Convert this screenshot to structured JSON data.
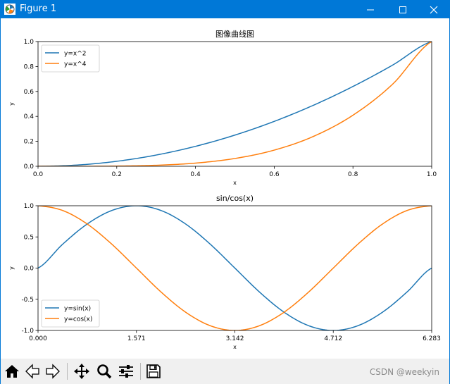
{
  "window": {
    "title": "Figure 1",
    "controls": {
      "minimize": "minimize",
      "maximize": "maximize",
      "close": "close"
    },
    "titlebar_color": "#0078d7"
  },
  "toolbar": {
    "buttons": [
      {
        "name": "home-button",
        "icon": "home-icon",
        "label": "Home"
      },
      {
        "name": "back-button",
        "icon": "back-arrow-icon",
        "label": "Back"
      },
      {
        "name": "forward-button",
        "icon": "forward-arrow-icon",
        "label": "Forward"
      },
      {
        "name": "pan-button",
        "icon": "move-icon",
        "label": "Pan"
      },
      {
        "name": "zoom-button",
        "icon": "magnifier-icon",
        "label": "Zoom"
      },
      {
        "name": "configure-subplots-button",
        "icon": "sliders-icon",
        "label": "Subplots"
      },
      {
        "name": "save-button",
        "icon": "save-icon",
        "label": "Save"
      }
    ],
    "watermark": "CSDN @weekyin"
  },
  "chart_data": [
    {
      "type": "line",
      "title": "图像曲线图",
      "xlabel": "x",
      "ylabel": "y",
      "xlim": [
        0.0,
        1.0
      ],
      "ylim": [
        0.0,
        1.0
      ],
      "xticks": [
        "0.0",
        "0.2",
        "0.4",
        "0.6",
        "0.8",
        "1.0"
      ],
      "xtick_values": [
        0.0,
        0.2,
        0.4,
        0.6,
        0.8,
        1.0
      ],
      "yticks": [
        "0.0",
        "0.2",
        "0.4",
        "0.6",
        "0.8",
        "1.0"
      ],
      "ytick_values": [
        0.0,
        0.2,
        0.4,
        0.6,
        0.8,
        1.0
      ],
      "legend_position": "upper-left",
      "series": [
        {
          "name": "y=x^2",
          "color": "#1f77b4",
          "x": [
            0.0,
            0.1,
            0.2,
            0.3,
            0.4,
            0.5,
            0.6,
            0.7,
            0.8,
            0.9,
            1.0
          ],
          "y": [
            0.0,
            0.01,
            0.04,
            0.09,
            0.16,
            0.25,
            0.36,
            0.49,
            0.64,
            0.81,
            1.0
          ]
        },
        {
          "name": "y=x^4",
          "color": "#ff7f0e",
          "x": [
            0.0,
            0.1,
            0.2,
            0.3,
            0.4,
            0.5,
            0.6,
            0.7,
            0.8,
            0.9,
            1.0
          ],
          "y": [
            0.0,
            0.0001,
            0.0016,
            0.0081,
            0.0256,
            0.0625,
            0.1296,
            0.2401,
            0.4096,
            0.6561,
            1.0
          ]
        }
      ]
    },
    {
      "type": "line",
      "title": "sin/cos(x)",
      "xlabel": "x",
      "ylabel": "y",
      "xlim": [
        0.0,
        6.283
      ],
      "ylim": [
        -1.0,
        1.0
      ],
      "xticks": [
        "0.000",
        "1.571",
        "3.142",
        "4.712",
        "6.283"
      ],
      "xtick_values": [
        0.0,
        1.571,
        3.142,
        4.712,
        6.283
      ],
      "yticks": [
        "-1.0",
        "-0.5",
        "0.0",
        "0.5",
        "1.0"
      ],
      "ytick_values": [
        -1.0,
        -0.5,
        0.0,
        0.5,
        1.0
      ],
      "legend_position": "lower-left",
      "series": [
        {
          "name": "y=sin(x)",
          "color": "#1f77b4",
          "x": [
            0.0,
            0.393,
            0.785,
            1.178,
            1.571,
            1.963,
            2.356,
            2.749,
            3.142,
            3.534,
            3.927,
            4.32,
            4.712,
            5.105,
            5.498,
            5.89,
            6.283
          ],
          "y": [
            0.0,
            0.383,
            0.707,
            0.924,
            1.0,
            0.924,
            0.707,
            0.383,
            0.0,
            -0.383,
            -0.707,
            -0.924,
            -1.0,
            -0.924,
            -0.707,
            -0.383,
            0.0
          ]
        },
        {
          "name": "y=cos(x)",
          "color": "#ff7f0e",
          "x": [
            0.0,
            0.393,
            0.785,
            1.178,
            1.571,
            1.963,
            2.356,
            2.749,
            3.142,
            3.534,
            3.927,
            4.32,
            4.712,
            5.105,
            5.498,
            5.89,
            6.283
          ],
          "y": [
            1.0,
            0.924,
            0.707,
            0.383,
            0.0,
            -0.383,
            -0.707,
            -0.924,
            -1.0,
            -0.924,
            -0.707,
            -0.383,
            0.0,
            0.383,
            0.707,
            0.924,
            1.0
          ]
        }
      ]
    }
  ]
}
